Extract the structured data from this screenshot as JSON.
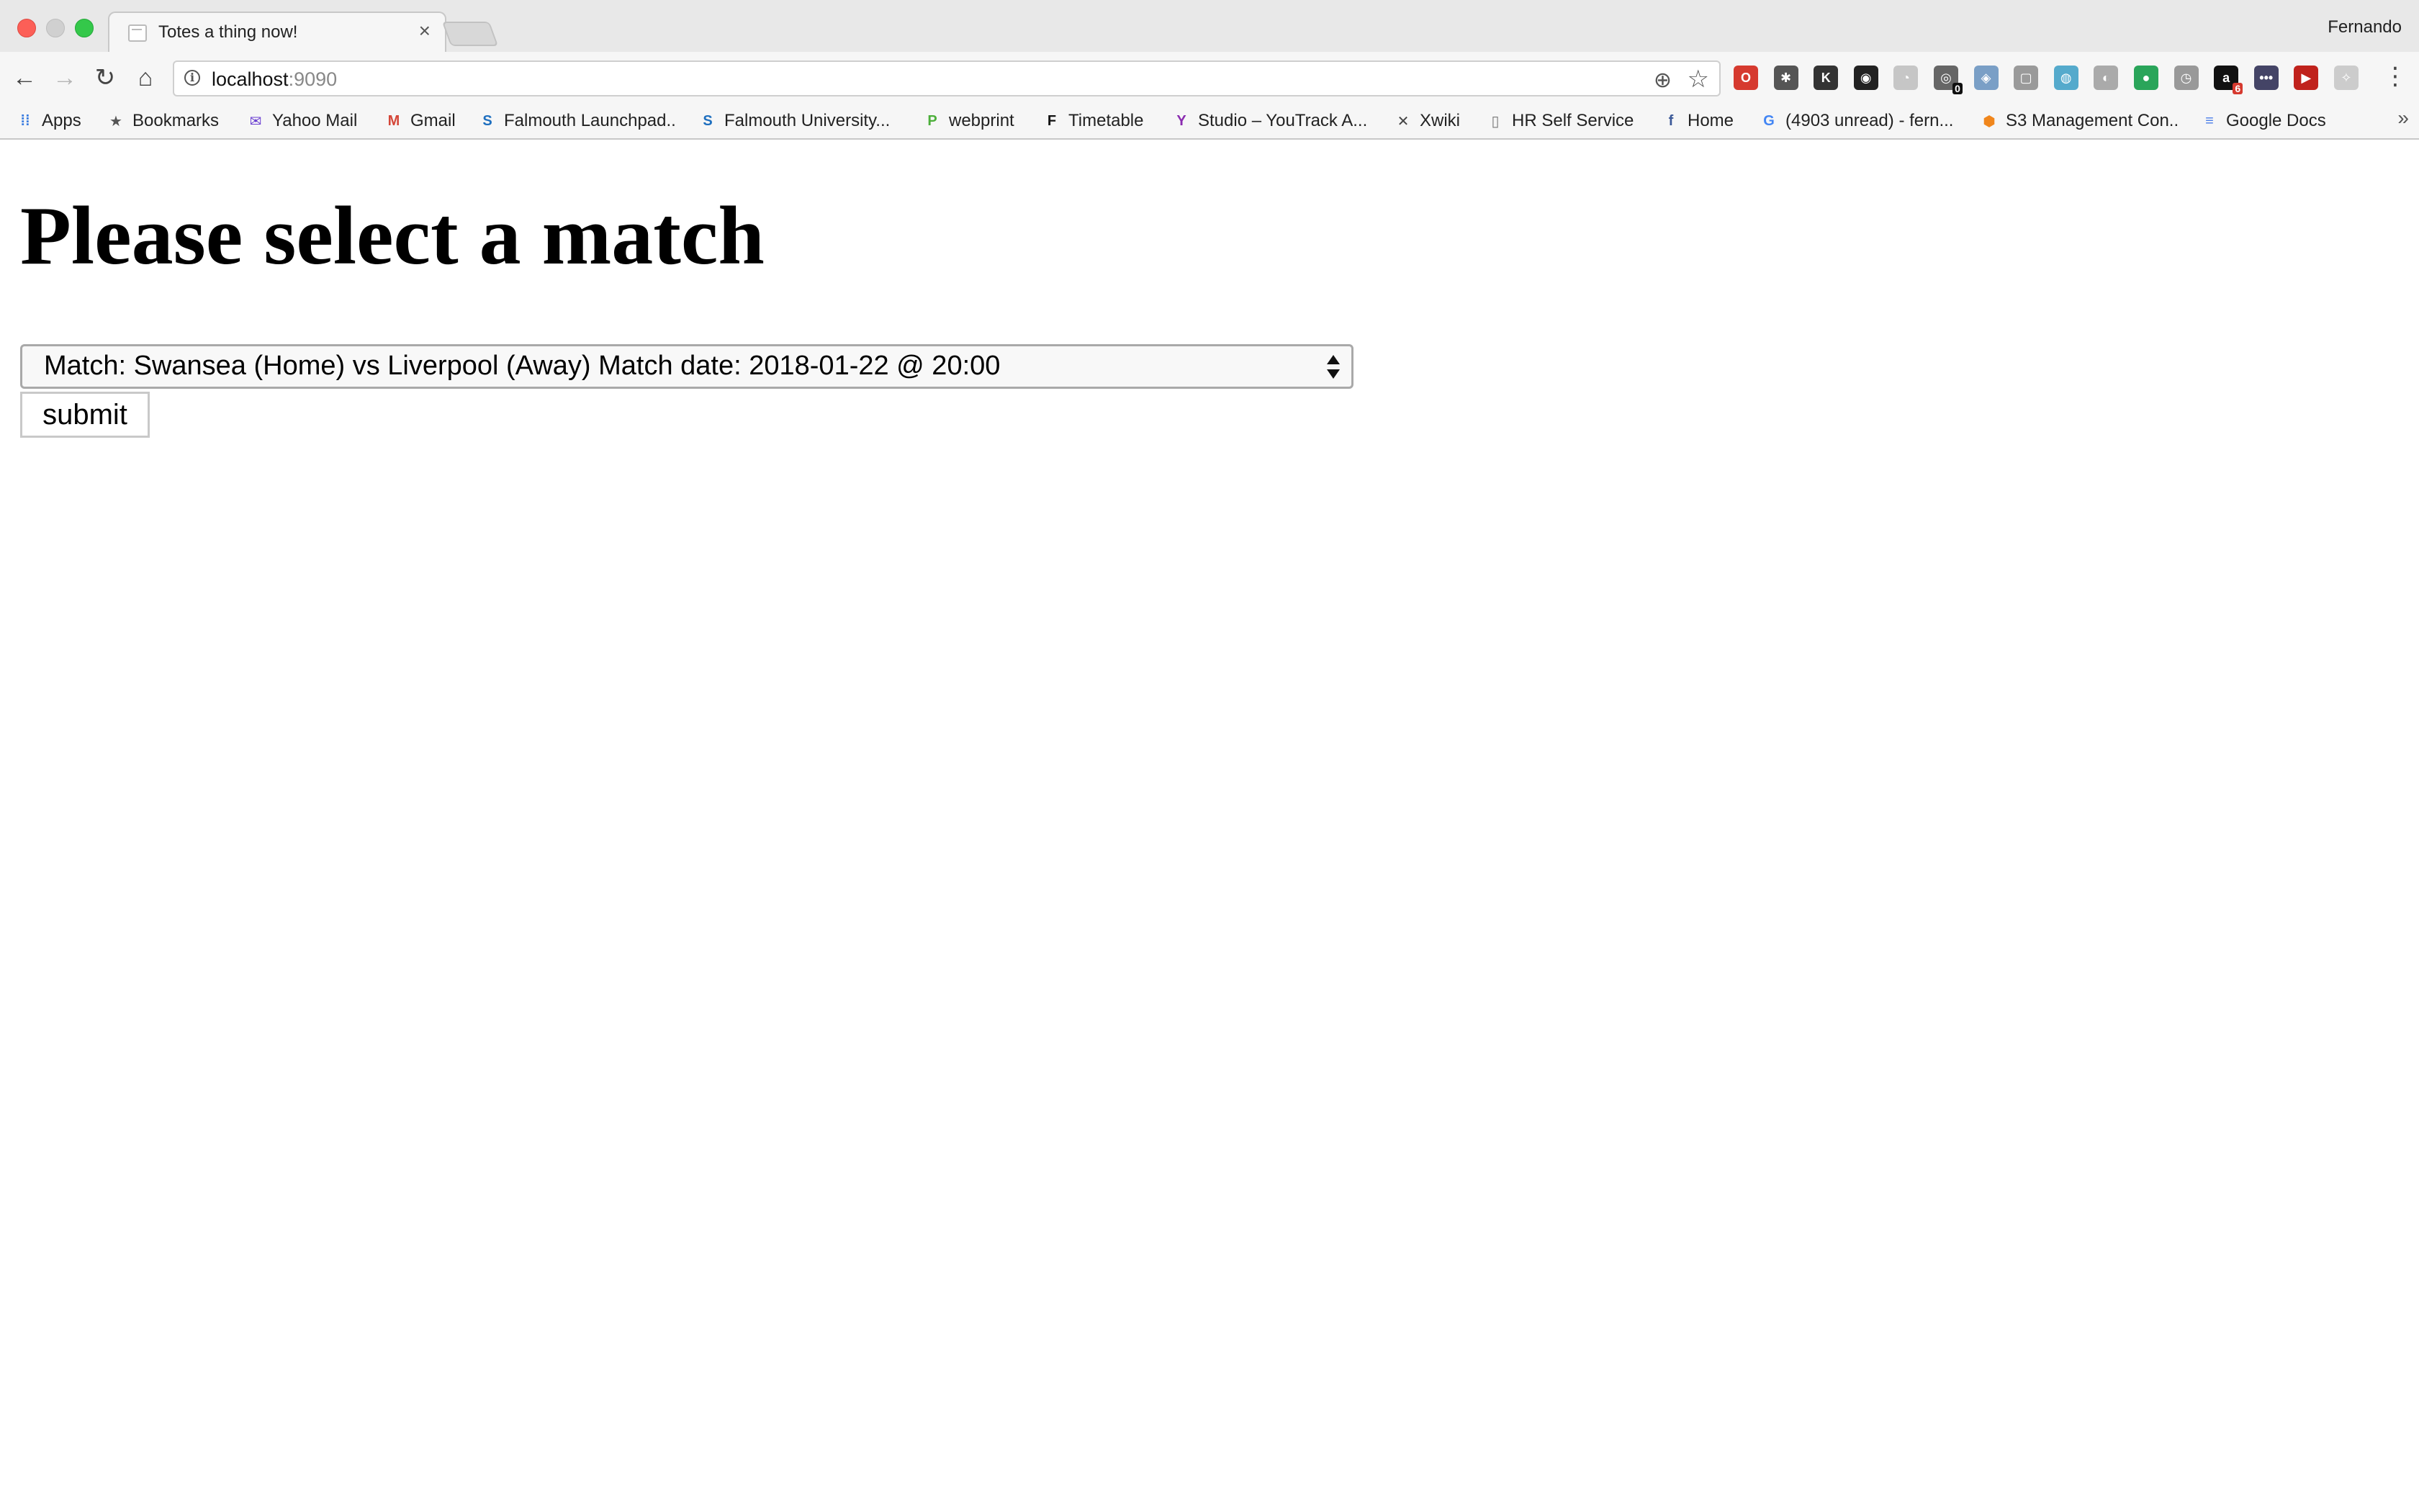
{
  "browser": {
    "tab_title": "Totes a thing now!",
    "tab_close": "×",
    "profile_name": "Fernando",
    "url_host": "localhost",
    "url_port": ":9090",
    "nav": {
      "back": "←",
      "forward": "→",
      "reload": "↻",
      "home": "⌂"
    },
    "omnibox_info": "i",
    "zoom_glyph": "⊕",
    "star_glyph": "☆",
    "menu_glyph": "⋮",
    "bookmarks_more": "»",
    "extensions": [
      {
        "name": "opera-icon",
        "glyph": "O",
        "color": "#d63a2f"
      },
      {
        "name": "bug-icon",
        "glyph": "✱",
        "color": "#555555"
      },
      {
        "name": "dark-ext-icon",
        "glyph": "K",
        "color": "#333333"
      },
      {
        "name": "mask-icon",
        "glyph": "◉",
        "color": "#222222"
      },
      {
        "name": "rss-icon",
        "glyph": "◔",
        "color": "#c6c6c6"
      },
      {
        "name": "ghost-icon",
        "glyph": "◎",
        "color": "#666666",
        "badge": "0",
        "badge_color": "#111111"
      },
      {
        "name": "translate-icon",
        "glyph": "◈",
        "color": "#7a9fc6"
      },
      {
        "name": "square-ext-icon",
        "glyph": "▢",
        "color": "#9a9a9a"
      },
      {
        "name": "globe-icon",
        "glyph": "◍",
        "color": "#55aacc"
      },
      {
        "name": "sphere-icon",
        "glyph": "◐",
        "color": "#aaaaaa"
      },
      {
        "name": "chat-icon",
        "glyph": "●",
        "color": "#2aa55a"
      },
      {
        "name": "clock-icon",
        "glyph": "◷",
        "color": "#999999"
      },
      {
        "name": "amazon-icon",
        "glyph": "a",
        "color": "#111111",
        "badge": "6",
        "badge_color": "#d63a2f"
      },
      {
        "name": "dots-ext-icon",
        "glyph": "•••",
        "color": "#444466"
      },
      {
        "name": "play-icon",
        "glyph": "▶",
        "color": "#c0221c"
      },
      {
        "name": "puzzle-icon",
        "glyph": "✧",
        "color": "#cccccc"
      }
    ],
    "bookmarks": [
      {
        "name": "bookmark-apps",
        "label": "Apps",
        "icon": "apps-icon",
        "glyph": "⁞⁞",
        "color": "#3b7de0"
      },
      {
        "name": "bookmark-bookmarks",
        "label": "Bookmarks",
        "icon": "star-icon",
        "glyph": "★",
        "color": "#555555"
      },
      {
        "name": "bookmark-yahoo-mail",
        "label": "Yahoo Mail",
        "icon": "envelope-icon",
        "glyph": "✉",
        "color": "#6a3fd1"
      },
      {
        "name": "bookmark-gmail",
        "label": "Gmail",
        "icon": "gmail-icon",
        "glyph": "M",
        "color": "#d44638"
      },
      {
        "name": "bookmark-falmouth-launchpad",
        "label": "Falmouth Launchpad..",
        "icon": "sharepoint-icon",
        "glyph": "S",
        "color": "#1e6fbf"
      },
      {
        "name": "bookmark-falmouth-university",
        "label": "Falmouth University...",
        "icon": "sharepoint-icon",
        "glyph": "S",
        "color": "#1e6fbf"
      },
      {
        "name": "bookmark-webprint",
        "label": "webprint",
        "icon": "webprint-icon",
        "glyph": "P",
        "color": "#4caf3a"
      },
      {
        "name": "bookmark-timetable",
        "label": "Timetable",
        "icon": "timetable-icon",
        "glyph": "F",
        "color": "#111111"
      },
      {
        "name": "bookmark-studio-youtrack",
        "label": "Studio – YouTrack A...",
        "icon": "youtrack-icon",
        "glyph": "Y",
        "color": "#8a2bb0"
      },
      {
        "name": "bookmark-xwiki",
        "label": "Xwiki",
        "icon": "xwiki-icon",
        "glyph": "✕",
        "color": "#444444"
      },
      {
        "name": "bookmark-hr-self-service",
        "label": "HR Self Service",
        "icon": "page-icon",
        "glyph": "▯",
        "color": "#777777"
      },
      {
        "name": "bookmark-home",
        "label": "Home",
        "icon": "facebook-icon",
        "glyph": "f",
        "color": "#3b5998"
      },
      {
        "name": "bookmark-gmail-unread",
        "label": "(4903 unread) - fern...",
        "icon": "google-icon",
        "glyph": "G",
        "color": "#4285f4"
      },
      {
        "name": "bookmark-s3",
        "label": "S3 Management Con..",
        "icon": "aws-icon",
        "glyph": "⬢",
        "color": "#f0861c"
      },
      {
        "name": "bookmark-google-docs",
        "label": "Google Docs",
        "icon": "docs-icon",
        "glyph": "≡",
        "color": "#4a7de8"
      }
    ]
  },
  "page": {
    "heading": "Please select a match",
    "select": {
      "selected_value": "Match: Swansea (Home) vs Liverpool (Away) Match date: 2018-01-22 @ 20:00"
    },
    "submit_label": "submit"
  },
  "colors": {
    "chrome_bg": "#e8e8e8",
    "toolbar_bg": "#f6f6f6",
    "page_bg": "#ffffff",
    "text": "#000000"
  }
}
